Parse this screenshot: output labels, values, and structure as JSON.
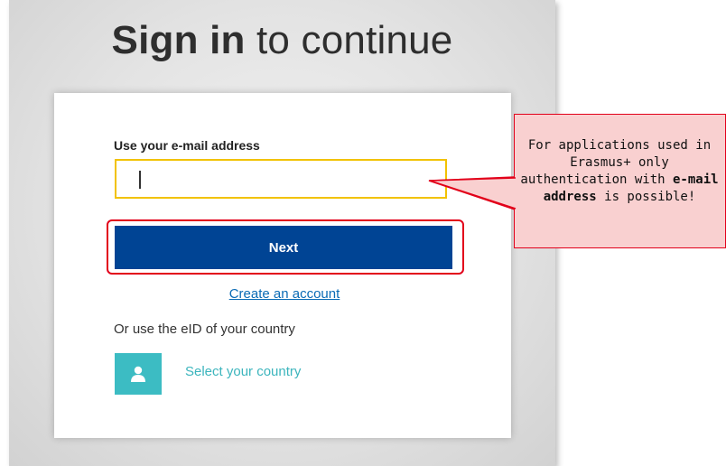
{
  "page": {
    "title_strong": "Sign in",
    "title_rest": " to continue"
  },
  "form": {
    "email_label": "Use your e-mail address",
    "email_value": "",
    "next_label": "Next",
    "create_account_label": "Create an account",
    "eid_text": "Or use the eID of your country",
    "select_country_label": "Select your country"
  },
  "callout": {
    "text_1": "For applications used in Erasmus+ only authentication with ",
    "text_bold": "e-mail address",
    "text_2": " is possible!"
  },
  "colors": {
    "primary_button": "#004494",
    "accent_teal": "#3cbcc3",
    "link_blue": "#0a6bb5",
    "highlight_red": "#e2001a",
    "input_border_yellow": "#f2c200",
    "callout_fill": "#f9d0d0"
  },
  "icons": {
    "country_icon": "person-icon"
  }
}
